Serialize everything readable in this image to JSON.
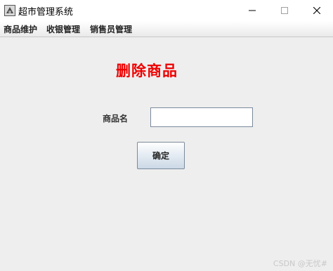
{
  "window": {
    "title": "超市管理系统",
    "icon": "java-app-icon"
  },
  "menu": {
    "items": [
      {
        "label": "商品维护"
      },
      {
        "label": "收银管理"
      },
      {
        "label": "销售员管理"
      }
    ]
  },
  "form": {
    "heading": "删除商品",
    "name_label": "商品名",
    "name_value": "",
    "confirm_label": "确定"
  },
  "watermark": "CSDN @无忧#",
  "colors": {
    "heading": "#ee0000",
    "background": "#eeeeee"
  }
}
